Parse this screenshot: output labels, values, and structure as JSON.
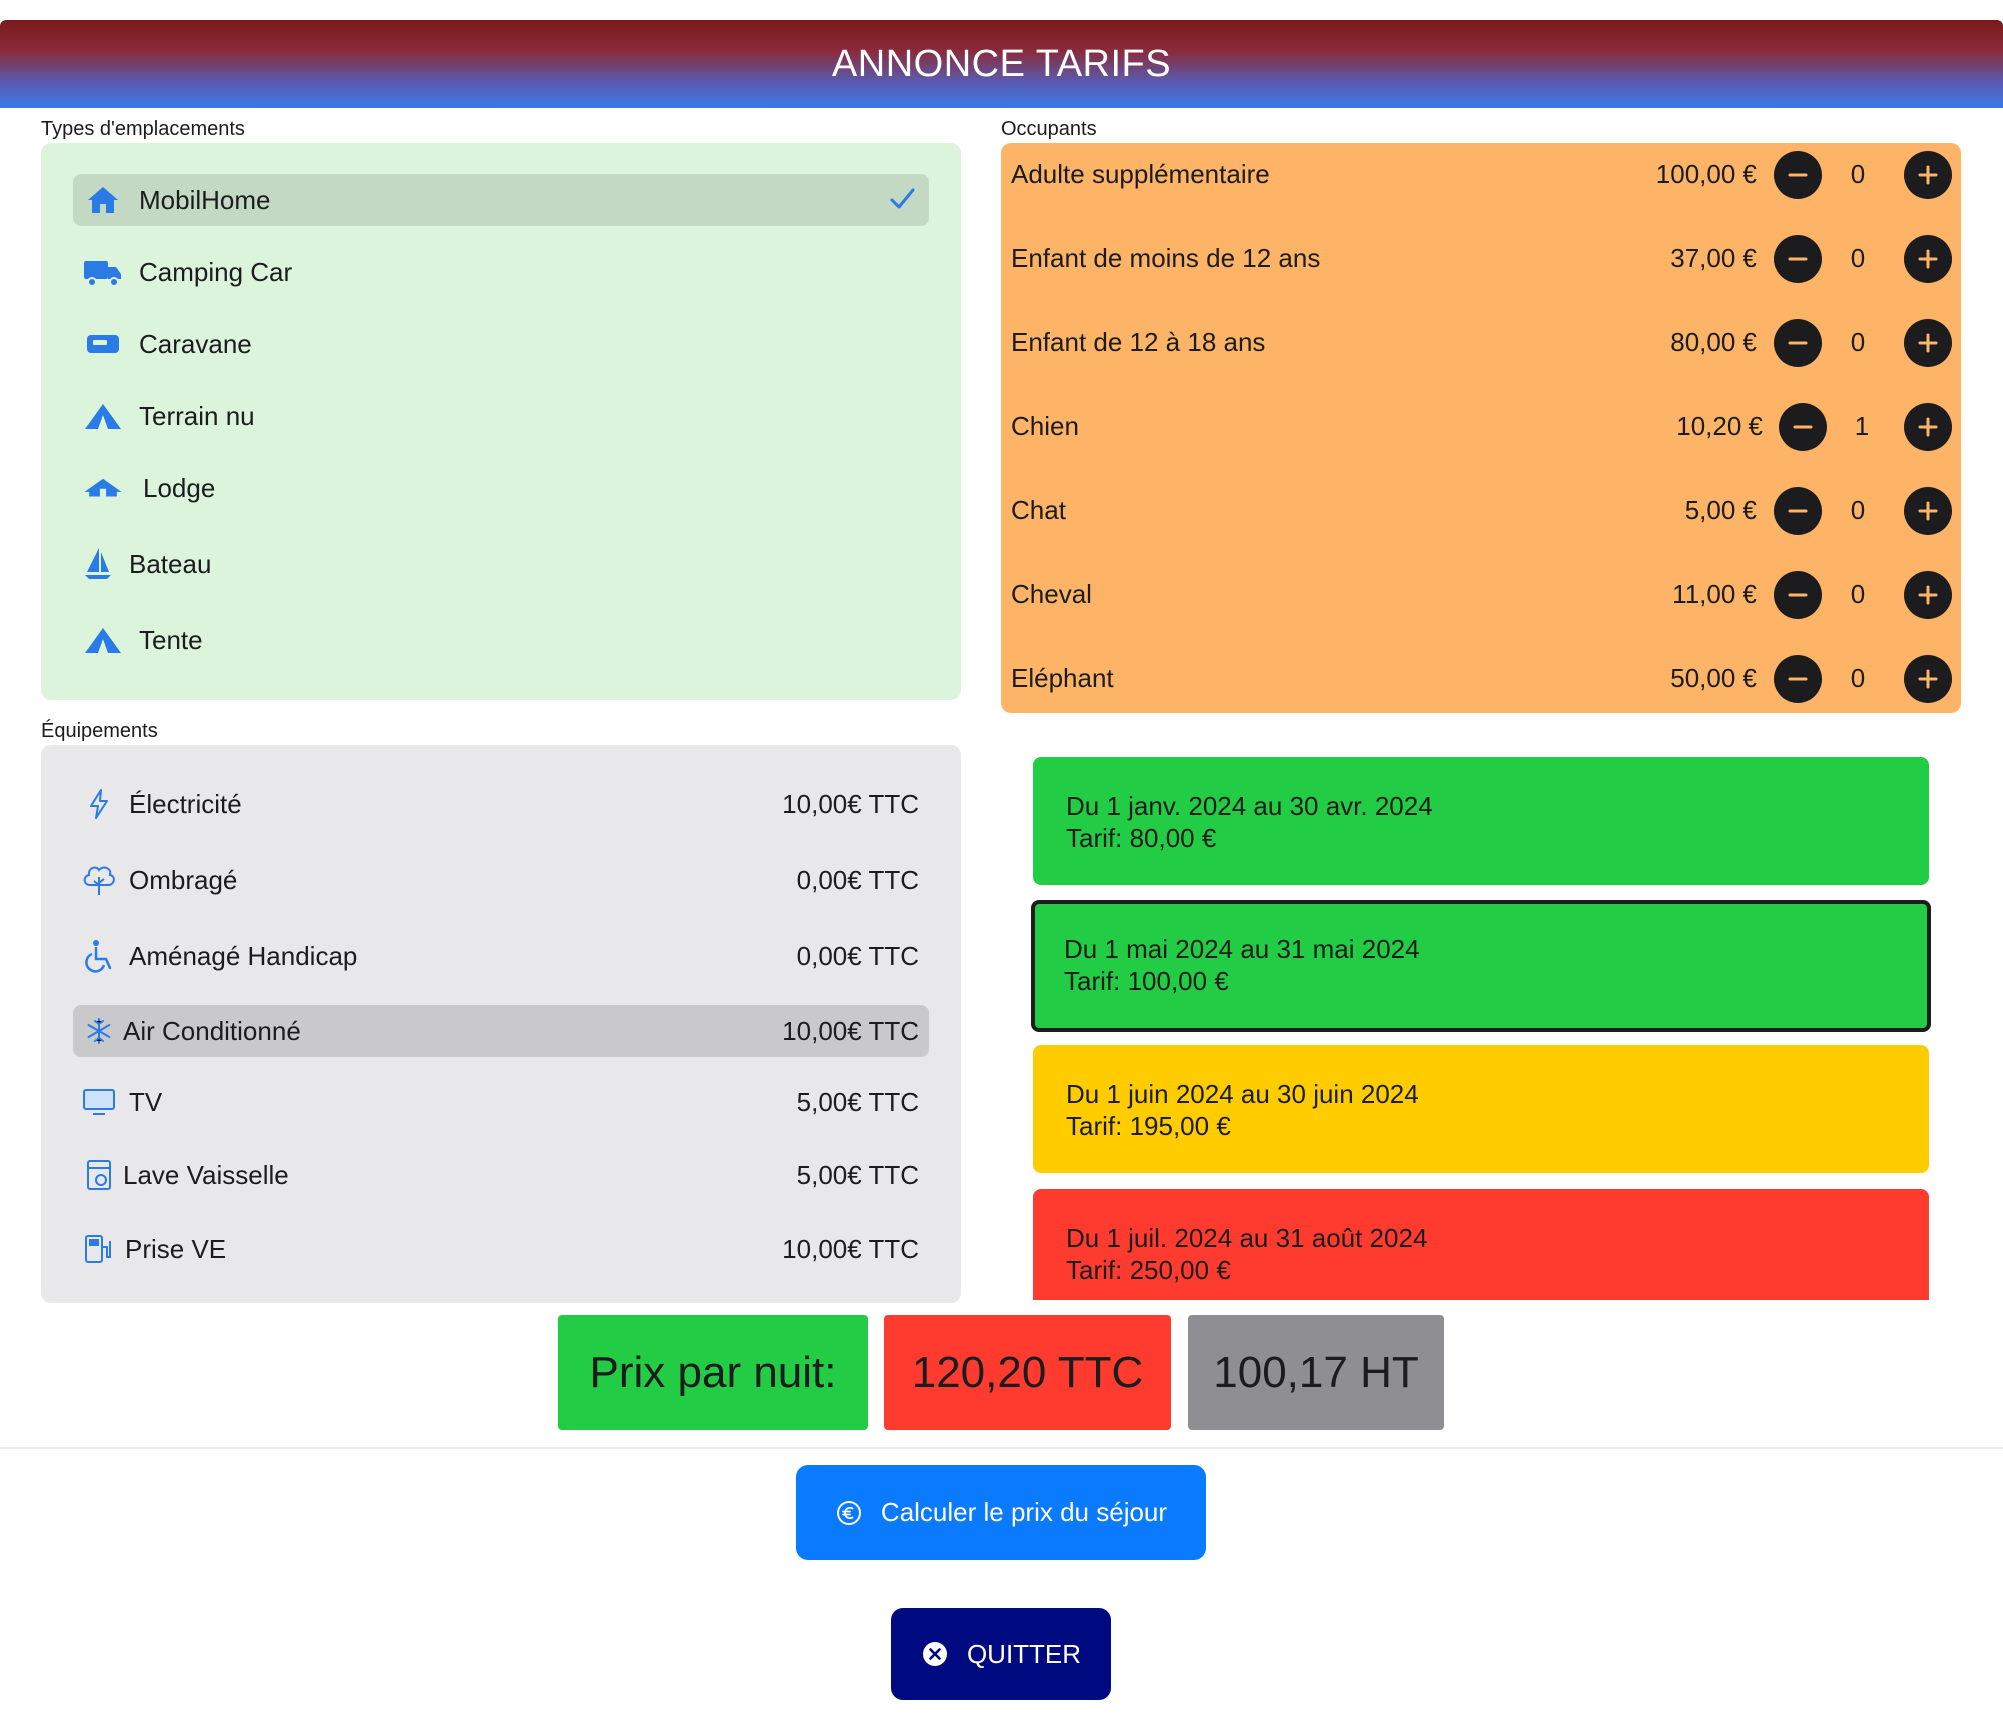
{
  "header": {
    "title": "ANNONCE TARIFS"
  },
  "types": {
    "label": "Types d'emplacements",
    "items": [
      {
        "label": "MobilHome",
        "icon": "house-icon",
        "selected": true
      },
      {
        "label": "Camping Car",
        "icon": "camper-van-icon"
      },
      {
        "label": "Caravane",
        "icon": "caravan-icon"
      },
      {
        "label": "Terrain nu",
        "icon": "tent-icon"
      },
      {
        "label": "Lodge",
        "icon": "lodge-icon"
      },
      {
        "label": "Bateau",
        "icon": "sailboat-icon"
      },
      {
        "label": "Tente",
        "icon": "tent-icon"
      }
    ]
  },
  "equipements": {
    "label": "Équipements",
    "items": [
      {
        "label": "Électricité",
        "price": "10,00€ TTC",
        "icon": "bolt-icon"
      },
      {
        "label": "Ombragé",
        "price": "0,00€ TTC",
        "icon": "tree-icon"
      },
      {
        "label": "Aménagé Handicap",
        "price": "0,00€ TTC",
        "icon": "wheelchair-icon"
      },
      {
        "label": "Air Conditionné",
        "price": "10,00€ TTC",
        "icon": "snowflake-icon",
        "selected": true
      },
      {
        "label": "TV",
        "price": "5,00€ TTC",
        "icon": "tv-icon"
      },
      {
        "label": "Lave Vaisselle",
        "price": "5,00€ TTC",
        "icon": "dishwasher-icon"
      },
      {
        "label": "Prise VE",
        "price": "10,00€ TTC",
        "icon": "ev-charger-icon"
      }
    ]
  },
  "occupants": {
    "label": "Occupants",
    "items": [
      {
        "label": "Adulte supplémentaire",
        "price": "100,00 €",
        "count": "0"
      },
      {
        "label": "Enfant de moins de 12 ans",
        "price": "37,00 €",
        "count": "0"
      },
      {
        "label": "Enfant de 12 à 18 ans",
        "price": "80,00 €",
        "count": "0"
      },
      {
        "label": "Chien",
        "price": "10,20 €",
        "count": "1"
      },
      {
        "label": "Chat",
        "price": "5,00 €",
        "count": "0"
      },
      {
        "label": "Cheval",
        "price": "11,00 €",
        "count": "0"
      },
      {
        "label": "Eléphant",
        "price": "50,00 €",
        "count": "0"
      }
    ]
  },
  "periods": [
    {
      "range": "Du 1 janv. 2024 au 30 avr. 2024",
      "tarif": "Tarif: 80,00 €",
      "color": "#22cc44"
    },
    {
      "range": "Du 1 mai 2024 au 31 mai 2024",
      "tarif": "Tarif: 100,00 €",
      "color": "#22cc44",
      "active": true
    },
    {
      "range": "Du 1 juin 2024 au 30 juin 2024",
      "tarif": "Tarif: 195,00 €",
      "color": "#ffcc00"
    },
    {
      "range": "Du 1 juil. 2024 au 31 août 2024",
      "tarif": "Tarif: 250,00 €",
      "color": "#ff3b30"
    }
  ],
  "summary": {
    "label": "Prix par nuit:",
    "ttc": "120,20 TTC",
    "ht": "100,17 HT",
    "colors": {
      "label": "#22cc44",
      "ttc": "#ff3b30",
      "ht": "#8e8e93"
    }
  },
  "actions": {
    "calculate": "Calculer le prix du séjour",
    "quit": "QUITTER"
  },
  "colors": {
    "accent": "#0a7aff",
    "quit": "#000a80"
  }
}
